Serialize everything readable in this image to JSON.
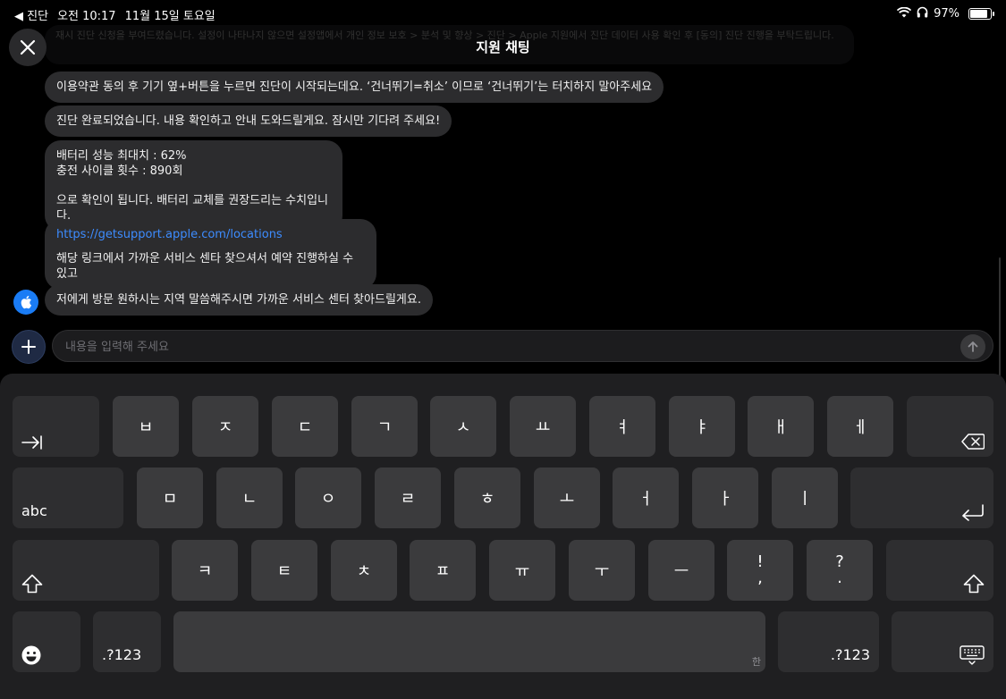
{
  "status": {
    "back_app": "◀ 진단",
    "time": "오전 10:17",
    "date": "11월 15일 토요일",
    "battery": "97%",
    "battery_level": 0.97
  },
  "header": {
    "title": "지원 채팅",
    "faded_text": "재시 진단 신청을 부여드렸습니다. 설정이 나타나지 않으면 설정앱에서 개인 정보 보호 > 분석 및 향상 > 진단 > Apple 지원에서 진단 데이터 사용 확인 후 [동의] 진단 진행을 부탁드립니다."
  },
  "messages": [
    {
      "text": "이용약관 동의 후 기기 옆+버튼을 누르면 진단이 시작되는데요. ‘건너뛰기=취소’ 이므로 ‘건너뛰기’는 터치하지 말아주세요"
    },
    {
      "text": "진단 완료되었습니다. 내용 확인하고 안내 도와드릴게요. 잠시만 기다려 주세요!"
    },
    {
      "line1": "배터리 성능 최대치 : 62%",
      "line2": "충전 사이클 횟수 : 890회",
      "line3": "으로 확인이 됩니다. 배터리 교체를 권장드리는 수치입니다."
    },
    {
      "link": "https://getsupport.apple.com/locations",
      "text": "해당 링크에서 가까운 서비스 센타 찾으셔서 예약 진행하실 수 있고"
    },
    {
      "text": "저에게 방문 원하시는 지역 말씀해주시면 가까운 서비스 센터 찾아드릴게요."
    }
  ],
  "input": {
    "placeholder": "내용을 입력해 주세요"
  },
  "keyboard": {
    "row1": [
      "ㅂ",
      "ㅈ",
      "ㄷ",
      "ㄱ",
      "ㅅ",
      "ㅛ",
      "ㅕ",
      "ㅑ",
      "ㅐ",
      "ㅔ"
    ],
    "row2": [
      "ㅁ",
      "ㄴ",
      "ㅇ",
      "ㄹ",
      "ㅎ",
      "ㅗ",
      "ㅓ",
      "ㅏ",
      "ㅣ"
    ],
    "row3": [
      "ㅋ",
      "ㅌ",
      "ㅊ",
      "ㅍ",
      "ㅠ",
      "ㅜ",
      "ㅡ"
    ],
    "punct1_top": "!",
    "punct1_bottom": ",",
    "punct2_top": "?",
    "punct2_bottom": ".",
    "abc_label": "abc",
    "num_left": ".?123",
    "num_right": ".?123",
    "space_hint": "한"
  },
  "colors": {
    "accent": "#3d8cff",
    "avatar": "#1a7cf5",
    "bubble": "#2c2c2e",
    "keyboard": "#1f1f21",
    "key": "#3b3b3d"
  }
}
